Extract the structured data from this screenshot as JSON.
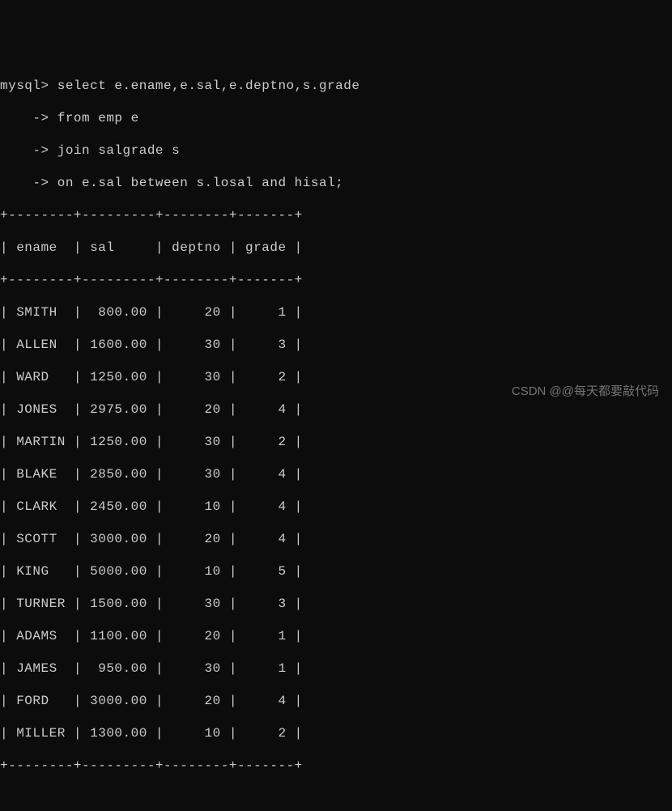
{
  "prompt": "mysql>",
  "cont_prompt": "    ->",
  "query": {
    "line1": " select e.ename,e.sal,e.deptno,s.grade",
    "line2": " from emp e",
    "line3": " join salgrade s",
    "line4": " on e.sal between s.losal and hisal;"
  },
  "columns": [
    "ename",
    "sal",
    "deptno",
    "grade"
  ],
  "divider": "+--------+---------+--------+-------+",
  "header": "| ename  | sal     | deptno | grade |",
  "rows": [
    "| SMITH  |  800.00 |     20 |     1 |",
    "| ALLEN  | 1600.00 |     30 |     3 |",
    "| WARD   | 1250.00 |     30 |     2 |",
    "| JONES  | 2975.00 |     20 |     4 |",
    "| MARTIN | 1250.00 |     30 |     2 |",
    "| BLAKE  | 2850.00 |     30 |     4 |",
    "| CLARK  | 2450.00 |     10 |     4 |",
    "| SCOTT  | 3000.00 |     20 |     4 |",
    "| KING   | 5000.00 |     10 |     5 |",
    "| TURNER | 1500.00 |     30 |     3 |",
    "| ADAMS  | 1100.00 |     20 |     1 |",
    "| JAMES  |  950.00 |     30 |     1 |",
    "| FORD   | 3000.00 |     20 |     4 |",
    "| MILLER | 1300.00 |     10 |     2 |"
  ],
  "chart_data": {
    "type": "table",
    "columns": [
      "ename",
      "sal",
      "deptno",
      "grade"
    ],
    "data": [
      {
        "ename": "SMITH",
        "sal": 800.0,
        "deptno": 20,
        "grade": 1
      },
      {
        "ename": "ALLEN",
        "sal": 1600.0,
        "deptno": 30,
        "grade": 3
      },
      {
        "ename": "WARD",
        "sal": 1250.0,
        "deptno": 30,
        "grade": 2
      },
      {
        "ename": "JONES",
        "sal": 2975.0,
        "deptno": 20,
        "grade": 4
      },
      {
        "ename": "MARTIN",
        "sal": 1250.0,
        "deptno": 30,
        "grade": 2
      },
      {
        "ename": "BLAKE",
        "sal": 2850.0,
        "deptno": 30,
        "grade": 4
      },
      {
        "ename": "CLARK",
        "sal": 2450.0,
        "deptno": 10,
        "grade": 4
      },
      {
        "ename": "SCOTT",
        "sal": 3000.0,
        "deptno": 20,
        "grade": 4
      },
      {
        "ename": "KING",
        "sal": 5000.0,
        "deptno": 10,
        "grade": 5
      },
      {
        "ename": "TURNER",
        "sal": 1500.0,
        "deptno": 30,
        "grade": 3
      },
      {
        "ename": "ADAMS",
        "sal": 1100.0,
        "deptno": 20,
        "grade": 1
      },
      {
        "ename": "JAMES",
        "sal": 950.0,
        "deptno": 30,
        "grade": 1
      },
      {
        "ename": "FORD",
        "sal": 3000.0,
        "deptno": 20,
        "grade": 4
      },
      {
        "ename": "MILLER",
        "sal": 1300.0,
        "deptno": 10,
        "grade": 2
      }
    ]
  },
  "watermark": "CSDN @@每天都要敲代码"
}
